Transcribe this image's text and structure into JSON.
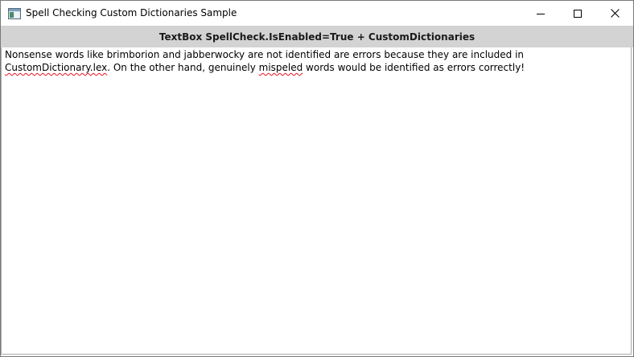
{
  "window": {
    "title": "Spell Checking Custom Dictionaries Sample"
  },
  "header": {
    "label": "TextBox SpellCheck.IsEnabled=True + CustomDictionaries"
  },
  "textbox": {
    "segments": [
      "Nonsense words like brimborion and jabberwocky are not identified are errors because they are included in ",
      "CustomDictionary.lex",
      ". On the other hand, genuinely ",
      "mispeled",
      " words would be identified as errors correctly!"
    ]
  },
  "icons": {
    "app": "app-window-icon",
    "minimize": "minimize-icon",
    "maximize": "maximize-icon",
    "close": "close-icon"
  }
}
